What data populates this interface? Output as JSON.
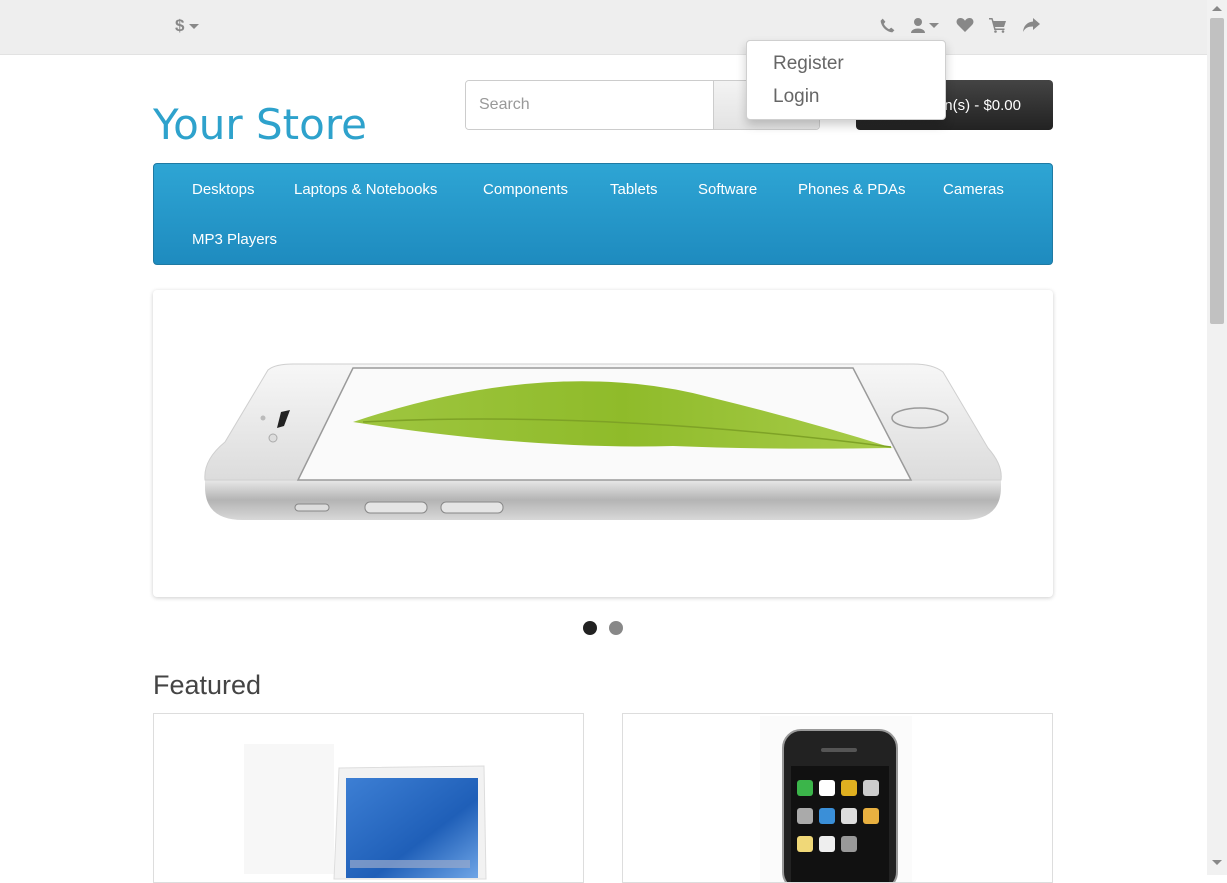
{
  "topbar": {
    "currency_symbol": "$",
    "icons": [
      "phone-icon",
      "user-icon",
      "heart-icon",
      "shopping-cart-icon",
      "share-icon"
    ]
  },
  "account_menu": {
    "items": [
      {
        "label": "Register"
      },
      {
        "label": "Login"
      }
    ]
  },
  "header": {
    "logo_text": "Your Store",
    "search_placeholder": "Search",
    "cart_label": "n(s) - $0.00"
  },
  "menu": {
    "items": [
      {
        "label": "Desktops"
      },
      {
        "label": "Laptops & Notebooks"
      },
      {
        "label": "Components"
      },
      {
        "label": "Tablets"
      },
      {
        "label": "Software"
      },
      {
        "label": "Phones & PDAs"
      },
      {
        "label": "Cameras"
      },
      {
        "label": "MP3 Players"
      }
    ]
  },
  "slideshow": {
    "active_slide": 1,
    "slide_count": 2
  },
  "featured": {
    "heading": "Featured"
  },
  "colors": {
    "brand": "#2ea2cc",
    "menu_bg": "#229ac8",
    "cart_bg": "#333333"
  }
}
